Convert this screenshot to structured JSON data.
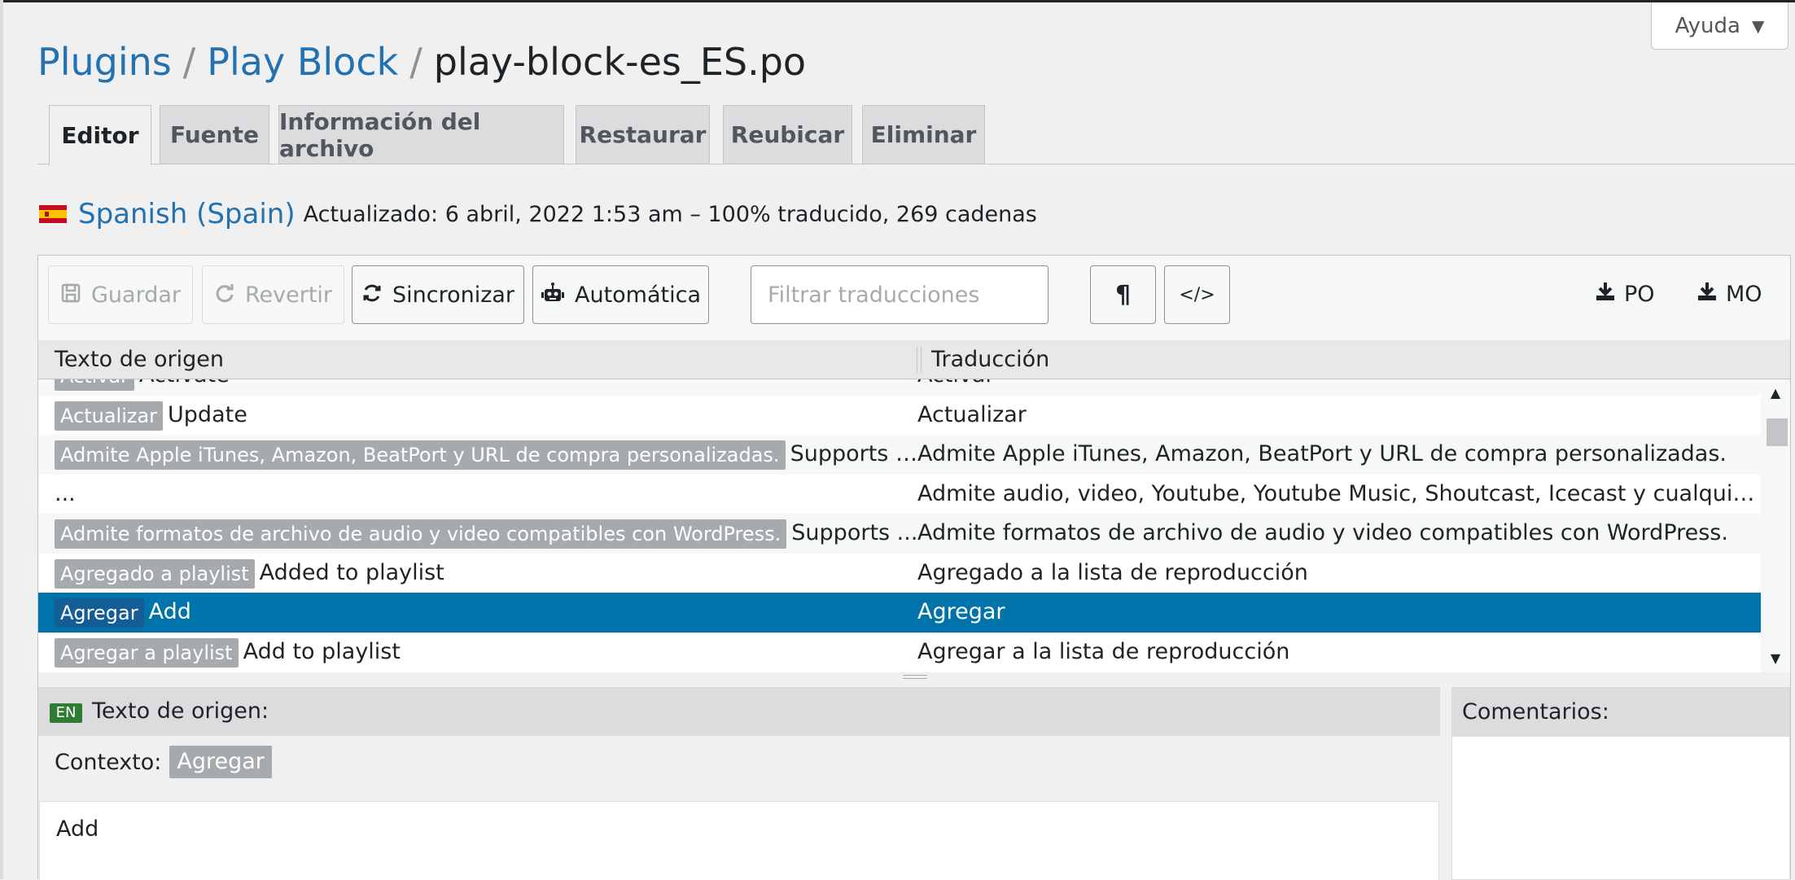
{
  "help": {
    "label": "Ayuda"
  },
  "breadcrumb": {
    "plugins": "Plugins",
    "plugin": "Play Block",
    "file": "play-block-es_ES.po",
    "separator": "/"
  },
  "tabs": [
    {
      "label": "Editor",
      "active": true
    },
    {
      "label": "Fuente"
    },
    {
      "label": "Información del archivo"
    },
    {
      "label": "Restaurar"
    },
    {
      "label": "Reubicar"
    },
    {
      "label": "Eliminar"
    }
  ],
  "locale": {
    "name": "Spanish (Spain)",
    "meta": "Actualizado: 6 abril, 2022 1:53 am – 100% traducido, 269 cadenas",
    "flag_colors": {
      "red": "#c60b1e",
      "yellow": "#ffc400"
    }
  },
  "toolbar": {
    "save": "Guardar",
    "revert": "Revertir",
    "sync": "Sincronizar",
    "auto": "Automática",
    "filter_placeholder": "Filtrar traducciones",
    "pilcrow_icon": "¶",
    "code_icon": "</>",
    "download_po": "PO",
    "download_mo": "MO"
  },
  "table": {
    "col_source": "Texto de origen",
    "col_translation": "Traducción",
    "rows": [
      {
        "ctx": "Activar",
        "source": "Activate",
        "translation": "Activar"
      },
      {
        "ctx": "Actualizar",
        "source": "Update",
        "translation": "Actualizar"
      },
      {
        "ctx": "Admite Apple iTunes, Amazon, BeatPort y URL de compra personalizadas.",
        "source": "Supports A...",
        "translation": "Admite Apple iTunes, Amazon, BeatPort y URL de compra personalizadas."
      },
      {
        "ctx": "",
        "source": "...",
        "translation": "Admite audio, video, Youtube, Youtube Music, Shoutcast, Icecast y cualquier otra ..."
      },
      {
        "ctx": "Admite formatos de archivo de audio y video compatibles con WordPress.",
        "source": "Supports ...",
        "translation": "Admite formatos de archivo de audio y video compatibles con WordPress."
      },
      {
        "ctx": "Agregado a playlist",
        "source": "Added to playlist",
        "translation": "Agregado a la lista de reproducción"
      },
      {
        "ctx": "Agregar",
        "source": "Add",
        "translation": "Agregar",
        "selected": true
      },
      {
        "ctx": "Agregar a playlist",
        "source": "Add to playlist",
        "translation": "Agregar a la lista de reproducción"
      }
    ]
  },
  "source_pane": {
    "lang": "EN",
    "title": "Texto de origen:",
    "context_label": "Contexto:",
    "context_value": "Agregar",
    "text": "Add"
  },
  "comments_pane": {
    "title": "Comentarios:"
  },
  "colors": {
    "accent": "#2271b1",
    "selected_row": "#0073aa",
    "badge_en": "#2e7d32"
  }
}
